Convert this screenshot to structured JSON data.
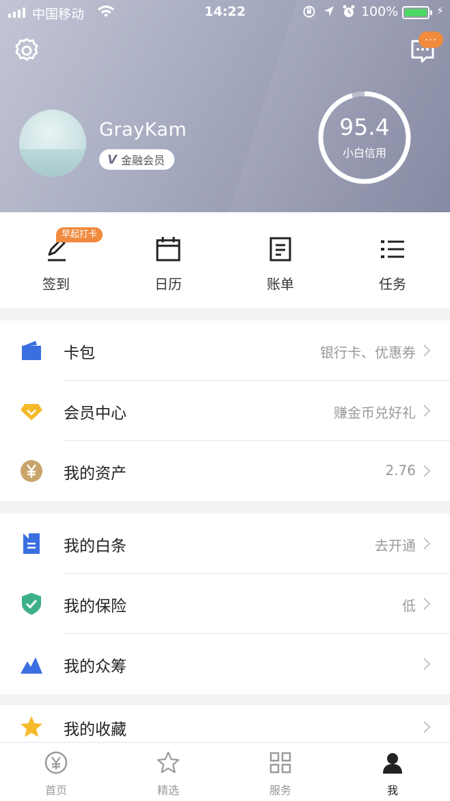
{
  "status_bar": {
    "carrier": "中国移动",
    "time": "14:22",
    "battery_percent": "100%"
  },
  "header": {
    "username": "GrayKam",
    "member_badge_mark": "V",
    "member_badge_label": "金融会员",
    "message_badge": "...",
    "score_value": "95.4",
    "score_label": "小白信用",
    "score_fraction": 0.954
  },
  "quick_actions": [
    {
      "label": "签到",
      "icon": "pen-icon",
      "tag": "早起打卡"
    },
    {
      "label": "日历",
      "icon": "calendar-icon"
    },
    {
      "label": "账单",
      "icon": "bill-icon"
    },
    {
      "label": "任务",
      "icon": "list-icon"
    }
  ],
  "sections": [
    {
      "rows": [
        {
          "title": "卡包",
          "value": "银行卡、优惠券",
          "icon": "wallet-icon"
        },
        {
          "title": "会员中心",
          "value": "赚金币兑好礼",
          "icon": "diamond-icon"
        },
        {
          "title": "我的资产",
          "value": "2.76",
          "icon": "yuan-coin-icon"
        }
      ]
    },
    {
      "rows": [
        {
          "title": "我的白条",
          "value": "去开通",
          "icon": "iou-icon"
        },
        {
          "title": "我的保险",
          "value": "低",
          "icon": "shield-icon"
        },
        {
          "title": "我的众筹",
          "value": "",
          "icon": "mountain-icon"
        }
      ]
    },
    {
      "rows": [
        {
          "title": "我的收藏",
          "value": "",
          "icon": "star-icon"
        }
      ]
    }
  ],
  "tabbar": [
    {
      "label": "首页",
      "icon": "yuan-icon",
      "active": false
    },
    {
      "label": "精选",
      "icon": "star-outline-icon",
      "active": false
    },
    {
      "label": "服务",
      "icon": "grid-icon",
      "active": false
    },
    {
      "label": "我",
      "icon": "person-icon",
      "active": true
    }
  ],
  "colors": {
    "accent_orange": "#ef8a3e",
    "icon_blue": "#3a6fe0",
    "diamond_yellow": "#f5b92a",
    "coin_gold": "#c9a46a",
    "shield_green": "#3db08a",
    "battery_green": "#4cd964"
  }
}
